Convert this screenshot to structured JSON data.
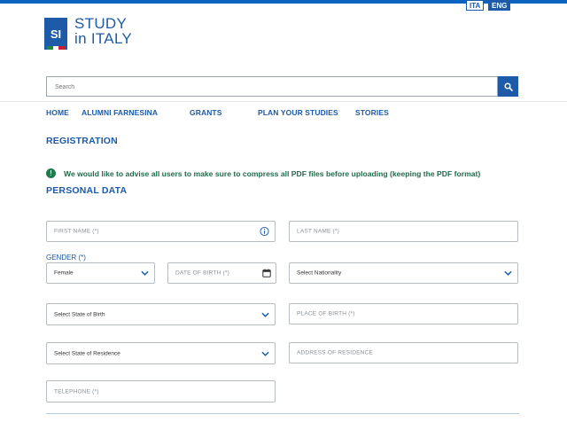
{
  "colors": {
    "brand": "#1d5aa8",
    "notice": "#1f7a4c",
    "topbar": "#0b64c0"
  },
  "logo": {
    "mark": "SI",
    "line1": "STUDY",
    "line2": "in ITALY"
  },
  "lang": {
    "ita": "ITA",
    "eng": "ENG",
    "selected": "ENG"
  },
  "search": {
    "placeholder": "Search",
    "icon": "search-icon"
  },
  "nav": {
    "items": [
      "HOME",
      "ALUMNI FARNESINA",
      "GRANTS",
      "PLAN YOUR STUDIES",
      "STORIES"
    ]
  },
  "registration": {
    "title": "REGISTRATION"
  },
  "notice": {
    "text": "We would like to advise all users to make sure to compress all PDF files before uploading (keeping the PDF format)",
    "icon": "exclamation-icon"
  },
  "personal": {
    "title": "PERSONAL DATA",
    "first_name": "FIRST NAME (*)",
    "last_name": "LAST NAME (*)",
    "gender_label": "GENDER (*)",
    "gender_value": "Female",
    "dob": "DATE OF BIRTH (*)",
    "nationality": "Select Nationality",
    "state_birth": "Select State of Birth",
    "place_birth": "PLACE OF BIRTH (*)",
    "state_residence": "Select State of Residence",
    "address_residence": "ADDRESS OF RESIDENCE",
    "telephone": "TELEPHONE (*)"
  }
}
